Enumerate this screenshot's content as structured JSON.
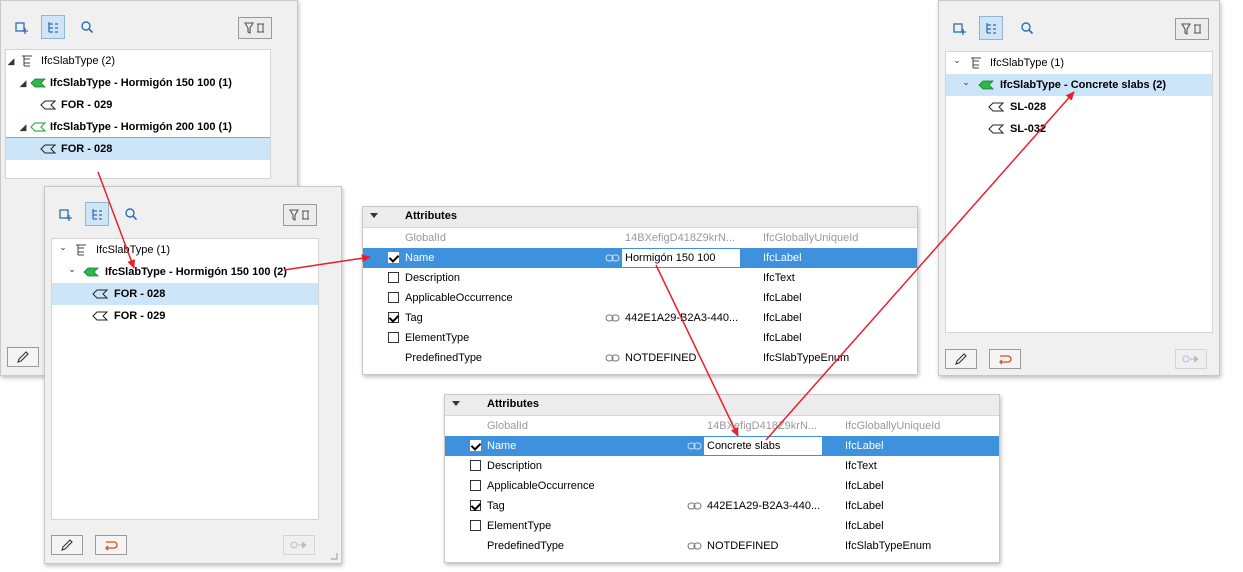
{
  "panel1": {
    "tree": [
      {
        "label": "IfcSlabType (2)",
        "bold": false,
        "icon": "type-tree-icon",
        "twisty": "◢"
      },
      {
        "label": "IfcSlabType - Hormigón 150 100 (1)",
        "bold": true,
        "icon": "slab-type-icon",
        "twisty": "◢"
      },
      {
        "label": "FOR - 029",
        "bold": true,
        "icon": "slab-icon",
        "twisty": ""
      },
      {
        "label": "IfcSlabType - Hormigón 200 100 (1)",
        "bold": true,
        "icon": "slab-type-icon",
        "twisty": "◢"
      },
      {
        "label": "FOR - 028",
        "bold": true,
        "icon": "slab-icon",
        "twisty": ""
      }
    ]
  },
  "panel2": {
    "tree": [
      {
        "label": "IfcSlabType (1)",
        "bold": false,
        "icon": "type-tree-icon",
        "twisty": "⌄"
      },
      {
        "label": "IfcSlabType - Hormigón 150 100 (2)",
        "bold": true,
        "icon": "slab-type-icon",
        "twisty": "⌄"
      },
      {
        "label": "FOR - 028",
        "bold": true,
        "icon": "slab-icon",
        "twisty": ""
      },
      {
        "label": "FOR - 029",
        "bold": true,
        "icon": "slab-icon",
        "twisty": ""
      }
    ]
  },
  "panel3": {
    "tree": [
      {
        "label": "IfcSlabType (1)",
        "bold": false,
        "icon": "type-tree-icon",
        "twisty": "⌄"
      },
      {
        "label": "IfcSlabType - Concrete slabs (2)",
        "bold": true,
        "icon": "slab-type-icon",
        "twisty": "⌄"
      },
      {
        "label": "SL-028",
        "bold": true,
        "icon": "slab-icon",
        "twisty": ""
      },
      {
        "label": "SL-032",
        "bold": true,
        "icon": "slab-icon",
        "twisty": ""
      }
    ]
  },
  "attributes1": {
    "header": "Attributes",
    "rows": [
      {
        "name": "GlobalId",
        "checkbox": null,
        "value": "14BXefigD418Z9krN...",
        "type": "IfcGloballyUniqueId",
        "link": false,
        "grey": true
      },
      {
        "name": "Name",
        "checkbox": true,
        "value": "Hormigón 150 100",
        "type": "IfcLabel",
        "link": true,
        "edit": true
      },
      {
        "name": "Description",
        "checkbox": false,
        "value": "",
        "type": "IfcText",
        "link": false
      },
      {
        "name": "ApplicableOccurrence",
        "checkbox": false,
        "value": "",
        "type": "IfcLabel",
        "link": false
      },
      {
        "name": "Tag",
        "checkbox": true,
        "value": "442E1A29-B2A3-440...",
        "type": "IfcLabel",
        "link": true
      },
      {
        "name": "ElementType",
        "checkbox": false,
        "value": "",
        "type": "IfcLabel",
        "link": false
      },
      {
        "name": "PredefinedType",
        "checkbox": null,
        "value": "NOTDEFINED",
        "type": "IfcSlabTypeEnum",
        "link": true
      }
    ]
  },
  "attributes2": {
    "header": "Attributes",
    "rows": [
      {
        "name": "GlobalId",
        "checkbox": null,
        "value": "14BXefigD418Z9krN...",
        "type": "IfcGloballyUniqueId",
        "link": false,
        "grey": true
      },
      {
        "name": "Name",
        "checkbox": true,
        "value": "Concrete slabs",
        "type": "IfcLabel",
        "link": true,
        "edit": true
      },
      {
        "name": "Description",
        "checkbox": false,
        "value": "",
        "type": "IfcText",
        "link": false
      },
      {
        "name": "ApplicableOccurrence",
        "checkbox": false,
        "value": "",
        "type": "IfcLabel",
        "link": false
      },
      {
        "name": "Tag",
        "checkbox": true,
        "value": "442E1A29-B2A3-440...",
        "type": "IfcLabel",
        "link": true
      },
      {
        "name": "ElementType",
        "checkbox": false,
        "value": "",
        "type": "IfcLabel",
        "link": false
      },
      {
        "name": "PredefinedType",
        "checkbox": null,
        "value": "NOTDEFINED",
        "type": "IfcSlabTypeEnum",
        "link": true
      }
    ]
  },
  "colors": {
    "accent": "#3d91dd",
    "selection": "#cde5f8",
    "arrow": "#e8202a",
    "slab_type_green": "#2db84a"
  }
}
